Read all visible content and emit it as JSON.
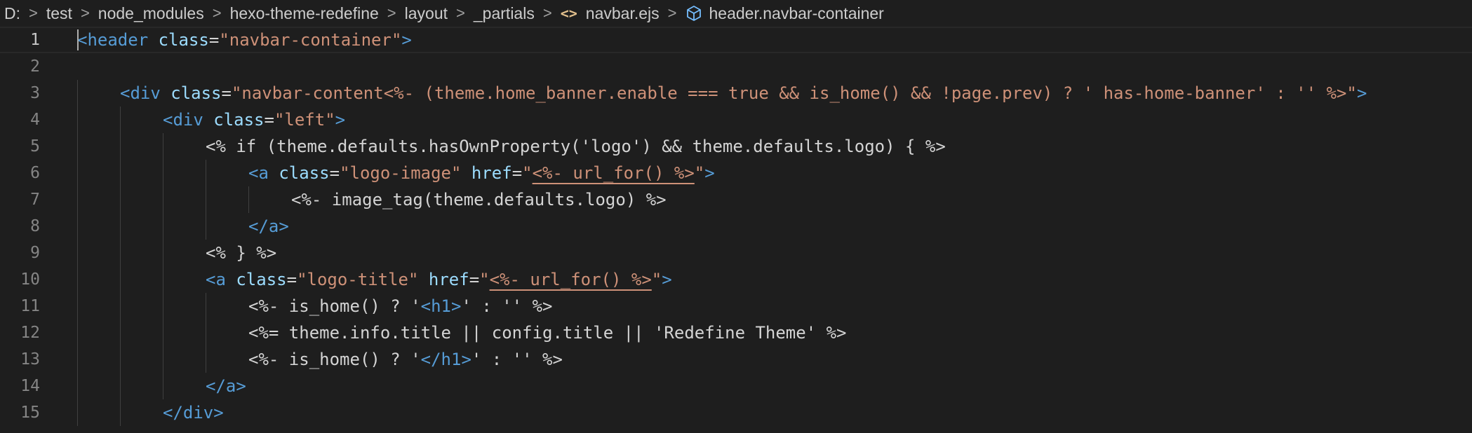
{
  "breadcrumb": {
    "segments": [
      "D:",
      "test",
      "node_modules",
      "hexo-theme-redefine",
      "layout",
      "_partials",
      "navbar.ejs",
      "header.navbar-container"
    ],
    "separator": ">"
  },
  "editor": {
    "active_line": 1,
    "lines": [
      {
        "n": "1",
        "indent": 0,
        "tokens": [
          {
            "c": "t",
            "v": "<header"
          },
          {
            "c": "e",
            "v": " "
          },
          {
            "c": "a",
            "v": "class"
          },
          {
            "c": "e",
            "v": "="
          },
          {
            "c": "s",
            "v": "\"navbar-container\""
          },
          {
            "c": "t",
            "v": ">"
          }
        ]
      },
      {
        "n": "2",
        "indent": 0,
        "tokens": []
      },
      {
        "n": "3",
        "indent": 1,
        "tokens": [
          {
            "c": "t",
            "v": "<div"
          },
          {
            "c": "e",
            "v": " "
          },
          {
            "c": "a",
            "v": "class"
          },
          {
            "c": "e",
            "v": "="
          },
          {
            "c": "s",
            "v": "\"navbar-content<%- (theme.home_banner.enable === true && is_home() && !page.prev) ? ' has-home-banner' : '' %>\""
          },
          {
            "c": "t",
            "v": ">"
          }
        ]
      },
      {
        "n": "4",
        "indent": 2,
        "tokens": [
          {
            "c": "t",
            "v": "<div"
          },
          {
            "c": "e",
            "v": " "
          },
          {
            "c": "a",
            "v": "class"
          },
          {
            "c": "e",
            "v": "="
          },
          {
            "c": "s",
            "v": "\"left\""
          },
          {
            "c": "t",
            "v": ">"
          }
        ]
      },
      {
        "n": "5",
        "indent": 3,
        "tokens": [
          {
            "c": "e",
            "v": "<% if (theme.defaults.hasOwnProperty('logo') && theme.defaults.logo) { %>"
          }
        ]
      },
      {
        "n": "6",
        "indent": 4,
        "tokens": [
          {
            "c": "t",
            "v": "<a"
          },
          {
            "c": "e",
            "v": " "
          },
          {
            "c": "a",
            "v": "class"
          },
          {
            "c": "e",
            "v": "="
          },
          {
            "c": "s",
            "v": "\"logo-image\""
          },
          {
            "c": "e",
            "v": " "
          },
          {
            "c": "a",
            "v": "href"
          },
          {
            "c": "e",
            "v": "="
          },
          {
            "c": "s",
            "v": "\""
          },
          {
            "c": "s u",
            "v": "<%- url_for() %>"
          },
          {
            "c": "s",
            "v": "\""
          },
          {
            "c": "t",
            "v": ">"
          }
        ]
      },
      {
        "n": "7",
        "indent": 5,
        "tokens": [
          {
            "c": "e",
            "v": "<%- image_tag(theme.defaults.logo) %>"
          }
        ]
      },
      {
        "n": "8",
        "indent": 4,
        "tokens": [
          {
            "c": "t",
            "v": "</a>"
          }
        ]
      },
      {
        "n": "9",
        "indent": 3,
        "tokens": [
          {
            "c": "e",
            "v": "<% } %>"
          }
        ]
      },
      {
        "n": "10",
        "indent": 3,
        "tokens": [
          {
            "c": "t",
            "v": "<a"
          },
          {
            "c": "e",
            "v": " "
          },
          {
            "c": "a",
            "v": "class"
          },
          {
            "c": "e",
            "v": "="
          },
          {
            "c": "s",
            "v": "\"logo-title\""
          },
          {
            "c": "e",
            "v": " "
          },
          {
            "c": "a",
            "v": "href"
          },
          {
            "c": "e",
            "v": "="
          },
          {
            "c": "s",
            "v": "\""
          },
          {
            "c": "s u",
            "v": "<%- url_for() %>"
          },
          {
            "c": "s",
            "v": "\""
          },
          {
            "c": "t",
            "v": ">"
          }
        ]
      },
      {
        "n": "11",
        "indent": 4,
        "tokens": [
          {
            "c": "e",
            "v": "<%- is_home() ? '"
          },
          {
            "c": "t",
            "v": "<h1>"
          },
          {
            "c": "e",
            "v": "' : '' %>"
          }
        ]
      },
      {
        "n": "12",
        "indent": 4,
        "tokens": [
          {
            "c": "e",
            "v": "<%= theme.info.title || config.title || 'Redefine Theme' %>"
          }
        ]
      },
      {
        "n": "13",
        "indent": 4,
        "tokens": [
          {
            "c": "e",
            "v": "<%- is_home() ? '"
          },
          {
            "c": "t",
            "v": "</h1>"
          },
          {
            "c": "e",
            "v": "' : '' %>"
          }
        ]
      },
      {
        "n": "14",
        "indent": 3,
        "tokens": [
          {
            "c": "t",
            "v": "</a>"
          }
        ]
      },
      {
        "n": "15",
        "indent": 2,
        "tokens": [
          {
            "c": "t",
            "v": "</div>"
          }
        ]
      }
    ]
  }
}
